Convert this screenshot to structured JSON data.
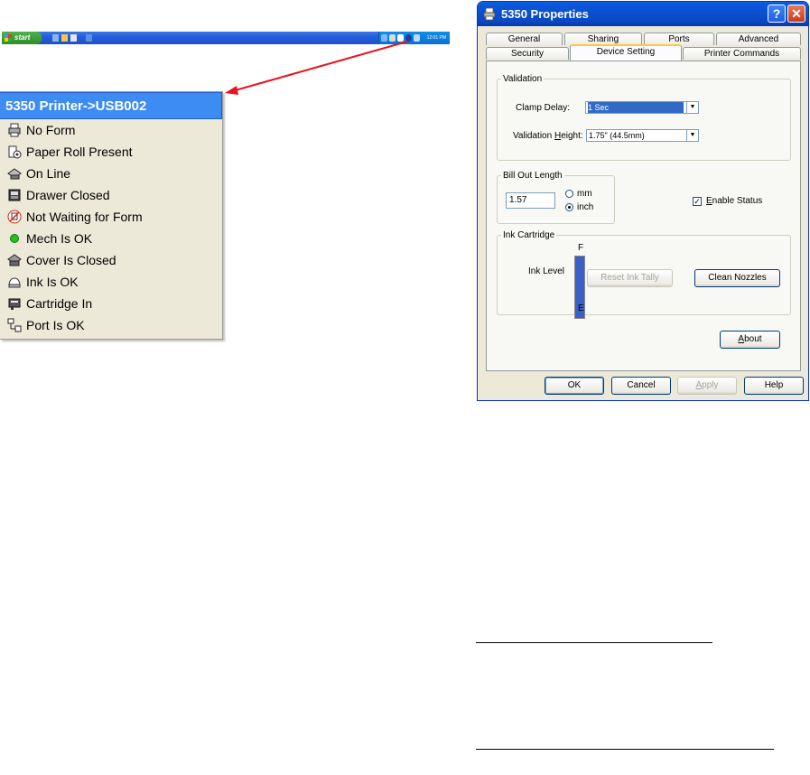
{
  "taskbar": {
    "start_label": "start",
    "clock": "12:01 PM"
  },
  "popup": {
    "title": "5350 Printer->USB002",
    "items": [
      {
        "label": "No Form",
        "icon": "printer-icon"
      },
      {
        "label": "Paper Roll Present",
        "icon": "paper-roll-icon"
      },
      {
        "label": "On Line",
        "icon": "online-printer-icon"
      },
      {
        "label": "Drawer Closed",
        "icon": "drawer-icon"
      },
      {
        "label": "Not Waiting for Form",
        "icon": "waiting-form-icon"
      },
      {
        "label": "Mech Is OK",
        "icon": "green-dot-icon"
      },
      {
        "label": "Cover Is Closed",
        "icon": "cover-icon"
      },
      {
        "label": "Ink Is OK",
        "icon": "ink-icon"
      },
      {
        "label": "Cartridge In",
        "icon": "cartridge-icon"
      },
      {
        "label": "Port Is OK",
        "icon": "port-icon"
      }
    ]
  },
  "dialog": {
    "title": "5350 Properties",
    "tabs_row1": [
      "General",
      "Sharing",
      "Ports",
      "Advanced"
    ],
    "tabs_row2": [
      "Security",
      "Device Setting",
      "Printer Commands"
    ],
    "active_tab": "Device Setting",
    "validation": {
      "legend": "Validation",
      "clamp_delay_label": "Clamp Delay:",
      "clamp_delay_value": "1 Sec",
      "validation_height_label_pre": "Validation ",
      "validation_height_label_key": "H",
      "validation_height_label_post": "eight:",
      "validation_height_value": "1.75\" (44.5mm)"
    },
    "bill_out": {
      "legend": "Bill Out Length",
      "value": "1.57",
      "unit_mm": "mm",
      "unit_inch": "inch",
      "selected_unit": "inch"
    },
    "enable_status": {
      "label_key": "E",
      "label_rest": "nable Status",
      "checked": true
    },
    "ink": {
      "legend": "Ink Cartridge",
      "level_label": "Ink Level",
      "full_label": "F",
      "empty_label": "E",
      "level_fraction": 1.0,
      "reset_button": "Reset Ink Tally",
      "clean_button": "Clean Nozzles"
    },
    "about_key": "A",
    "about_rest": "bout",
    "buttons": {
      "ok": "OK",
      "cancel": "Cancel",
      "apply_key": "A",
      "apply_rest": "pply",
      "help": "Help"
    }
  },
  "colors": {
    "xp_blue": "#0a5ee8",
    "popup_title": "#3c8cf3",
    "arrow": "#e8141e",
    "mech_ok": "#22c022",
    "ink_fill": "#3a5fc8"
  }
}
